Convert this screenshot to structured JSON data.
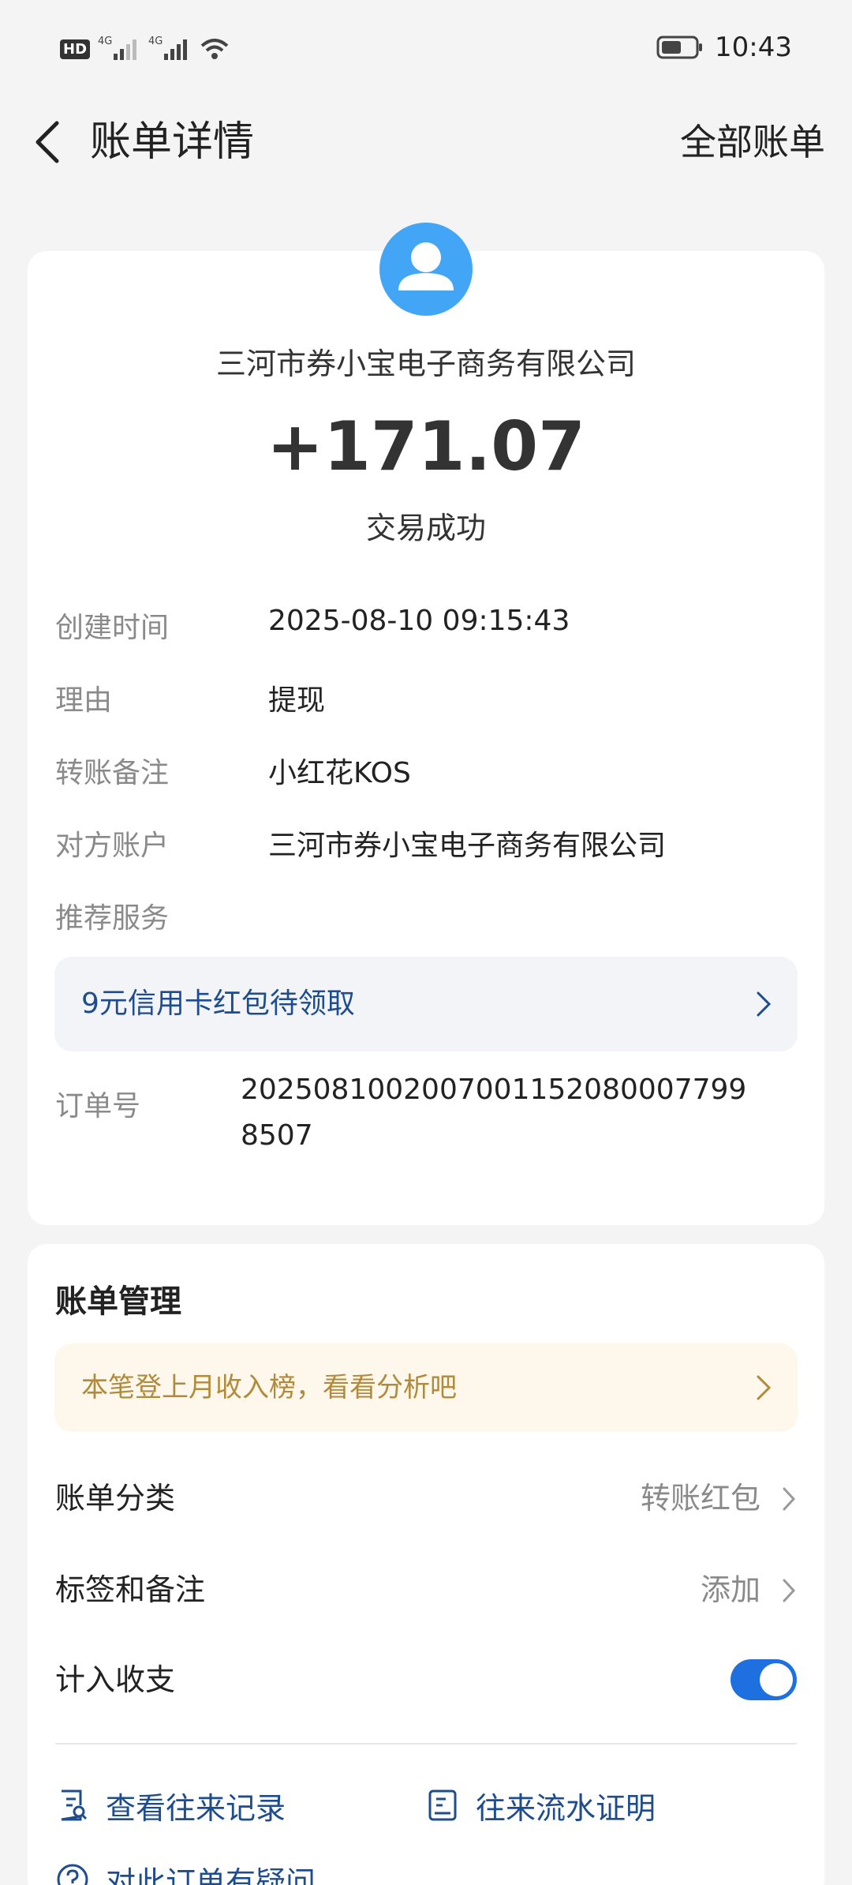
{
  "status_bar": {
    "hd": "HD",
    "sim1": "4G",
    "sim2": "4G",
    "time": "10:43"
  },
  "nav": {
    "title": "账单详情",
    "right": "全部账单"
  },
  "bill": {
    "company": "三河市券小宝电子商务有限公司",
    "amount": "+171.07",
    "status": "交易成功",
    "details": [
      {
        "label": "创建时间",
        "value": "2025-08-10 09:15:43"
      },
      {
        "label": "理由",
        "value": "提现"
      },
      {
        "label": "转账备注",
        "value": "小红花KOS"
      },
      {
        "label": "对方账户",
        "value": "三河市券小宝电子商务有限公司"
      },
      {
        "label": "推荐服务",
        "value": ""
      }
    ],
    "promo": "9元信用卡红包待领取",
    "order_label": "订单号",
    "order_value": "20250810020070011520800077998507"
  },
  "manage": {
    "title": "账单管理",
    "analysis": "本笔登上月收入榜，看看分析吧",
    "category_label": "账单分类",
    "category_value": "转账红包",
    "tags_label": "标签和备注",
    "tags_value": "添加",
    "include_label": "计入收支",
    "include_on": true,
    "link_records": "查看往来记录",
    "link_proof": "往来流水证明",
    "link_question": "对此订单有疑问"
  },
  "colors": {
    "accent": "#1e6fe0",
    "avatar": "#42a5f5",
    "promo_text": "#1d4c8f",
    "analysis_text": "#b28a3a"
  }
}
